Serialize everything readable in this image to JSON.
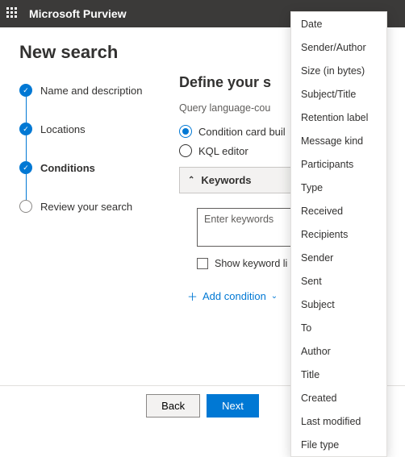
{
  "header": {
    "brand": "Microsoft Purview"
  },
  "page": {
    "title": "New search"
  },
  "steps": [
    {
      "label": "Name and description",
      "state": "done"
    },
    {
      "label": "Locations",
      "state": "done"
    },
    {
      "label": "Conditions",
      "state": "current"
    },
    {
      "label": "Review your search",
      "state": "pending"
    }
  ],
  "main": {
    "section_title": "Define your s",
    "subtext_prefix": "Query language-cou",
    "radio_card": "Condition card buil",
    "radio_kql": "KQL editor",
    "keywords_header": "Keywords",
    "keywords_placeholder": "Enter keywords",
    "show_list": "Show keyword li",
    "add_condition": "Add condition"
  },
  "footer": {
    "back": "Back",
    "next": "Next"
  },
  "dropdown": [
    "Date",
    "Sender/Author",
    "Size (in bytes)",
    "Subject/Title",
    "Retention label",
    "Message kind",
    "Participants",
    "Type",
    "Received",
    "Recipients",
    "Sender",
    "Sent",
    "Subject",
    "To",
    "Author",
    "Title",
    "Created",
    "Last modified",
    "File type"
  ]
}
